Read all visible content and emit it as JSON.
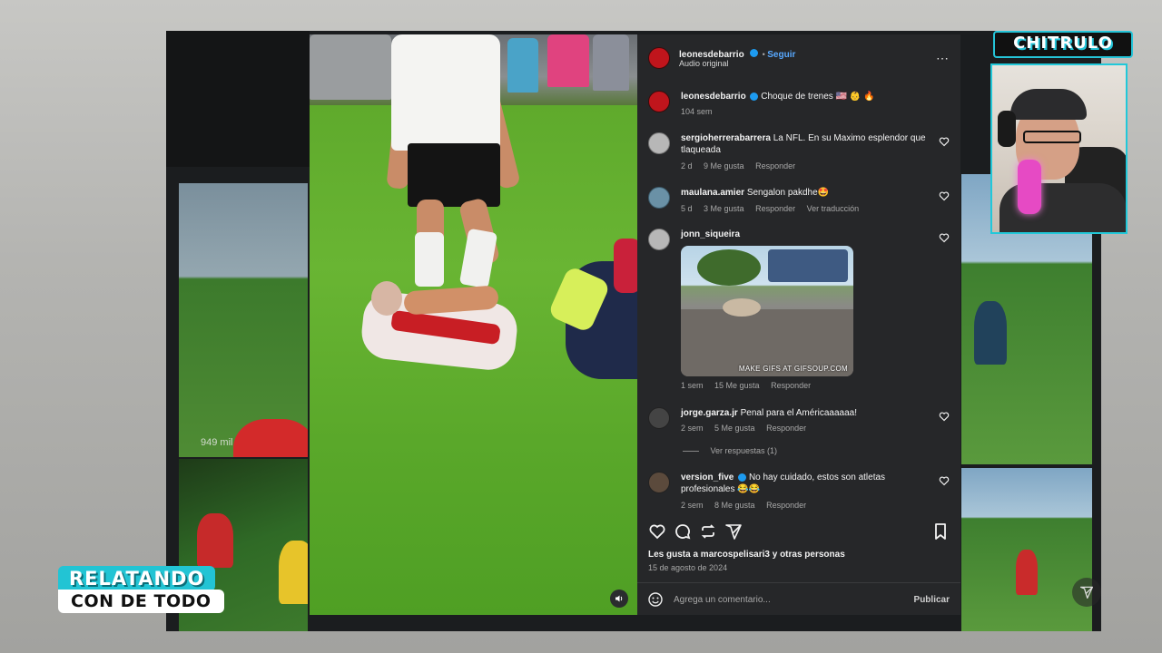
{
  "post": {
    "author": "leonesdebarrio",
    "follow_label": "Seguir",
    "audio_label": "Audio original",
    "caption": "Choque de trenes 🇺🇸 👶 🔥",
    "caption_time": "104 sem",
    "likes_text": "Les gusta a marcospelisari3 y otras personas",
    "date": "15 de agosto de 2024",
    "more_icon": "⋯"
  },
  "comments": [
    {
      "user": "sergioherrerabarrera",
      "text": "La NFL. En su Maximo esplendor que tlaqueada",
      "time": "2 d",
      "likes": "9 Me gusta",
      "reply": "Responder"
    },
    {
      "user": "maulana.amier",
      "text": "Sengalon pakdhe🤩",
      "time": "5 d",
      "likes": "3 Me gusta",
      "reply": "Responder",
      "translate": "Ver traducción"
    },
    {
      "user": "jonn_siqueira",
      "gif_caption": "MAKE GIFS AT GIFSOUP.COM",
      "time": "1 sem",
      "likes": "15 Me gusta",
      "reply": "Responder"
    },
    {
      "user": "jorge.garza.jr",
      "text": "Penal para el Américaaaaaa!",
      "time": "2 sem",
      "likes": "5 Me gusta",
      "reply": "Responder",
      "view_replies": "Ver respuestas (1)"
    },
    {
      "user": "version_five",
      "text": "No hay cuidado, estos son atletas profesionales 😂😂",
      "time": "2 sem",
      "likes": "8 Me gusta",
      "reply": "Responder"
    }
  ],
  "composer": {
    "placeholder": "Agrega un comentario...",
    "publish_label": "Publicar"
  },
  "background": {
    "views_text": "949 mil"
  },
  "overlay": {
    "brand": "CHITRULO",
    "lower_third_top": "RELATANDO",
    "lower_third_bottom": "CON DE TODO"
  },
  "colors": {
    "accent_cyan": "#22c4d4",
    "follow_blue": "#58a9ff",
    "panel_bg": "#262729"
  }
}
